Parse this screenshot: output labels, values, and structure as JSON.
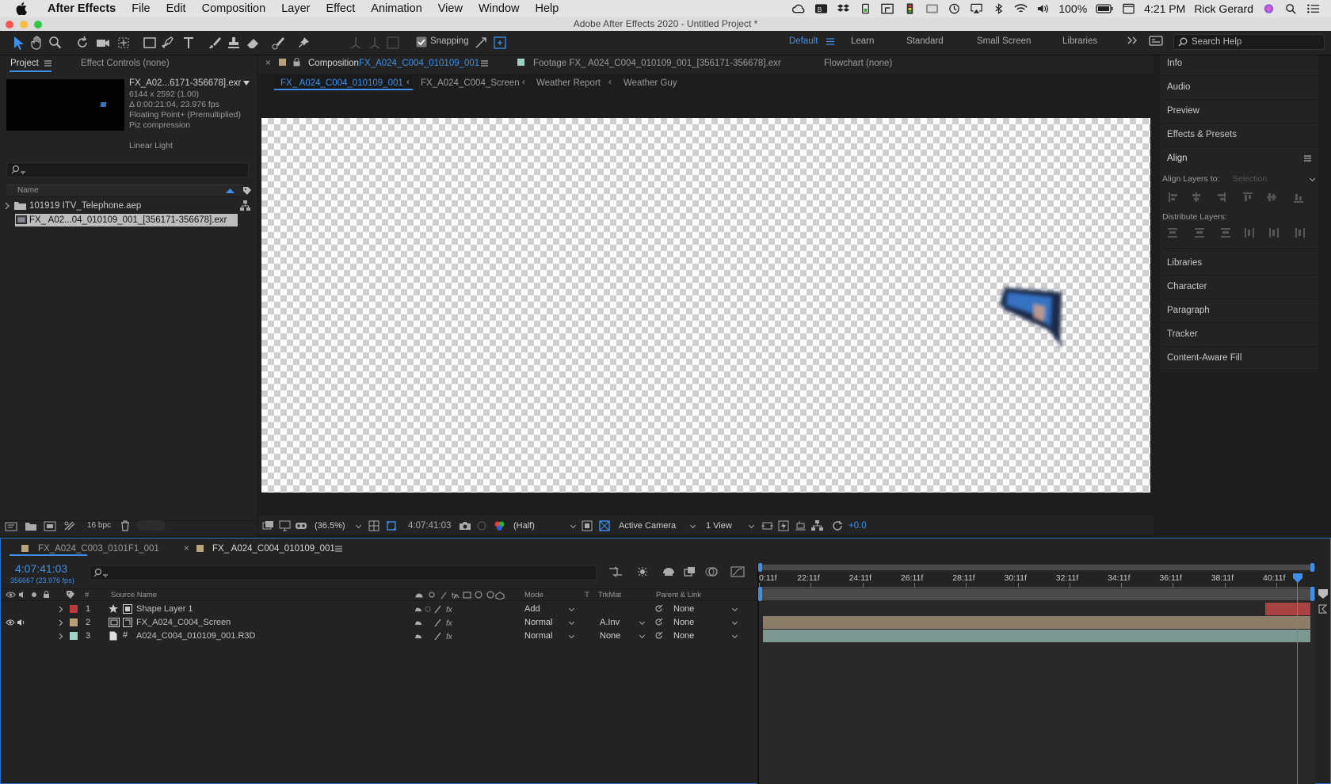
{
  "menubar": {
    "app": "After Effects",
    "items": [
      "File",
      "Edit",
      "Composition",
      "Layer",
      "Effect",
      "Animation",
      "View",
      "Window",
      "Help"
    ],
    "battery": "100%",
    "time": "4:21 PM",
    "user": "Rick Gerard"
  },
  "window": {
    "title": "Adobe After Effects 2020 - Untitled Project *"
  },
  "toolbar": {
    "snapping": "Snapping",
    "workspaces": [
      "Default",
      "Learn",
      "Standard",
      "Small Screen",
      "Libraries"
    ],
    "search_placeholder": "Search Help"
  },
  "project": {
    "tab": "Project",
    "effect_controls": "Effect Controls (none)",
    "footage_name": "FX_A02...6171-356678].exr",
    "info": [
      "6144 x 2592 (1.00)",
      "Δ 0:00:21:04, 23.976 fps",
      "Floating Point+ (Premultiplied)",
      "Piz compression"
    ],
    "linear_light": "Linear Light",
    "col_name": "Name",
    "items": [
      {
        "label": "101919 ITV_Telephone.aep",
        "type": "folder"
      },
      {
        "label": "FX_ A02...04_010109_001_[356171-356678].exr",
        "type": "footage"
      }
    ],
    "bpc": "16 bpc"
  },
  "viewer": {
    "comp_prefix": "Composition",
    "comp_name": "FX_A024_C004_010109_001",
    "footage_tab": "Footage FX_ A024_C004_010109_001_[356171-356678].exr",
    "flowchart_tab": "Flowchart (none)",
    "breadcrumb": [
      "FX_ A024_C004_010109_001",
      "FX_A024_C004_Screen",
      "Weather Report",
      "Weather Guy"
    ],
    "zoom": "(36.5%)",
    "timecode": "4:07:41:03",
    "resolution": "(Half)",
    "camera": "Active Camera",
    "views": "1 View",
    "exposure": "+0.0"
  },
  "right_panel": {
    "items": [
      "Info",
      "Audio",
      "Preview",
      "Effects & Presets"
    ],
    "align": {
      "title": "Align",
      "layers_to": "Align Layers to:",
      "selection": "Selection",
      "distribute": "Distribute Layers:"
    },
    "items2": [
      "Libraries",
      "Character",
      "Paragraph",
      "Tracker",
      "Content-Aware Fill"
    ]
  },
  "timeline": {
    "tabs": [
      "FX_A024_C003_0101F1_001",
      "FX_ A024_C004_010109_001"
    ],
    "timecode": "4:07:41:03",
    "frame_info": "356667 (23.976 fps)",
    "cols": {
      "num": "#",
      "source": "Source Name",
      "mode": "Mode",
      "t": "T",
      "trkmat": "TrkMat",
      "parent": "Parent & Link"
    },
    "layers": [
      {
        "num": "1",
        "name": "Shape Layer 1",
        "mode": "Add",
        "trkmat": "",
        "parent": "None",
        "color": "#b83a3a",
        "bar": "#a94243"
      },
      {
        "num": "2",
        "name": "FX_A024_C004_Screen",
        "mode": "Normal",
        "trkmat": "A.Inv",
        "parent": "None",
        "color": "#b89f78",
        "bar": "#8c7d69"
      },
      {
        "num": "3",
        "name": "A024_C004_010109_001.R3D",
        "mode": "Normal",
        "trkmat": "None",
        "parent": "None",
        "color": "#a3d4c8",
        "bar": "#7c9890"
      }
    ],
    "ruler": [
      "0:11f",
      "22:11f",
      "24:11f",
      "26:11f",
      "28:11f",
      "30:11f",
      "32:11f",
      "34:11f",
      "36:11f",
      "38:11f",
      "40:11f"
    ]
  }
}
